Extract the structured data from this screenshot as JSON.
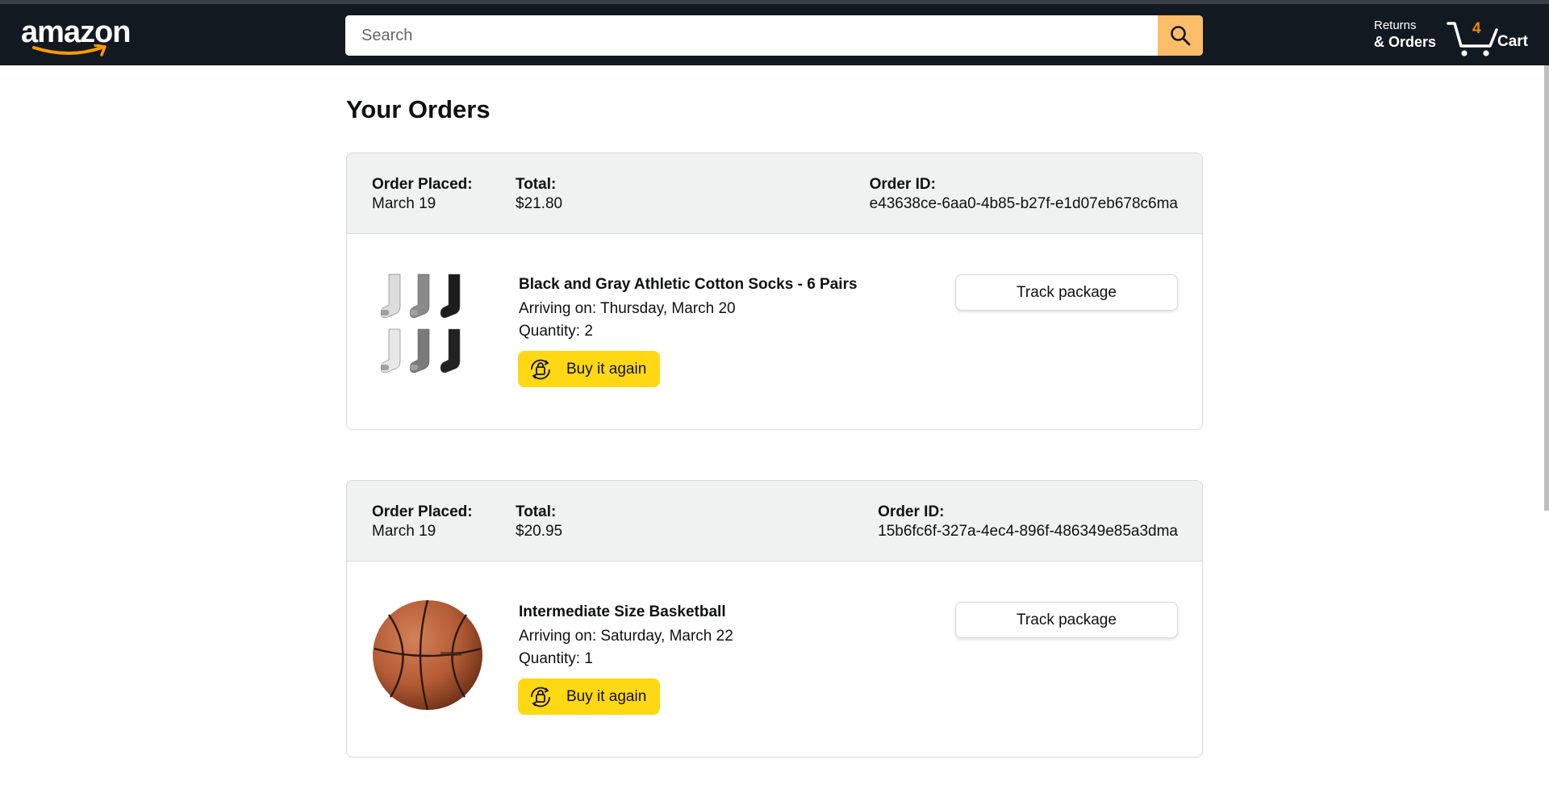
{
  "header": {
    "logo": "amazon",
    "search": {
      "placeholder": "Search",
      "value": ""
    },
    "returns_line1": "Returns",
    "returns_line2": "& Orders",
    "cart_count": "4",
    "cart_label": "Cart"
  },
  "page_title": "Your Orders",
  "orders": [
    {
      "placed_label": "Order Placed:",
      "placed_date": "March 19",
      "total_label": "Total:",
      "total": "$21.80",
      "id_label": "Order ID:",
      "order_id": "e43638ce-6aa0-4b85-b27f-e1d07eb678c6ma",
      "product_name": "Black and Gray Athletic Cotton Socks - 6 Pairs",
      "arriving": "Arriving on: Thursday, March 20",
      "quantity": "Quantity: 2",
      "buy_label": "Buy it again",
      "track_label": "Track package"
    },
    {
      "placed_label": "Order Placed:",
      "placed_date": "March 19",
      "total_label": "Total:",
      "total": "$20.95",
      "id_label": "Order ID:",
      "order_id": "15b6fc6f-327a-4ec4-896f-486349e85a3dma",
      "product_name": "Intermediate Size Basketball",
      "arriving": "Arriving on: Saturday, March 22",
      "quantity": "Quantity: 1",
      "buy_label": "Buy it again",
      "track_label": "Track package"
    }
  ],
  "colors": {
    "header_bg": "#131921",
    "search_button": "#febd69",
    "buy_button": "#ffd814",
    "cart_count": "#f08804"
  }
}
